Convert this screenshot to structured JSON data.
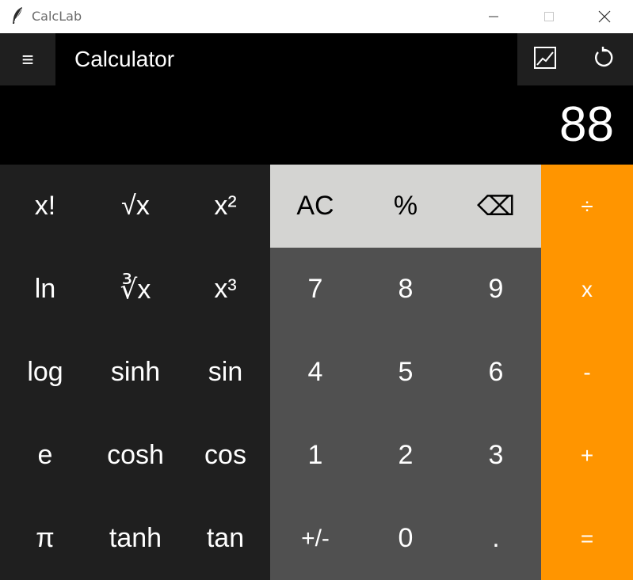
{
  "window": {
    "title": "CalcLab",
    "app_icon": "feather-icon",
    "controls": [
      "minimize-icon",
      "maximize-icon",
      "close-icon"
    ]
  },
  "header": {
    "menu_icon": "≡",
    "title": "Calculator",
    "graph_icon": "graph-icon",
    "history_icon": "history-icon"
  },
  "display": {
    "value": "88"
  },
  "keys": {
    "row1": [
      "x!",
      "√x",
      "x²",
      "AC",
      "%",
      "⌫",
      "÷"
    ],
    "row2": [
      "ln",
      "∛x",
      "x³",
      "7",
      "8",
      "9",
      "x"
    ],
    "row3": [
      "log",
      "sinh",
      "sin",
      "4",
      "5",
      "6",
      "-"
    ],
    "row4": [
      "e",
      "cosh",
      "cos",
      "1",
      "2",
      "3",
      "+"
    ],
    "row5": [
      "π",
      "tanh",
      "tan",
      "+/-",
      "0",
      ".",
      "="
    ]
  },
  "colors": {
    "scientific_bg": "#1f1f1f",
    "number_bg": "#505050",
    "function_bg": "#d4d4d2",
    "operator_bg": "#ff9500",
    "display_bg": "#000000"
  }
}
